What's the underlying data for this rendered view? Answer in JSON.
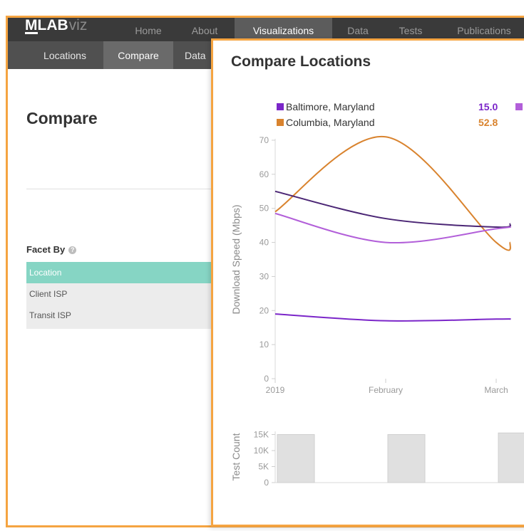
{
  "nav": {
    "logo": {
      "bold": "MLAB",
      "light": "viz"
    },
    "items": [
      "Home",
      "About",
      "Visualizations",
      "Data",
      "Tests",
      "Publications"
    ],
    "active_index": 2
  },
  "subnav": {
    "items": [
      "Locations",
      "Compare",
      "Data"
    ],
    "active_index": 1
  },
  "sidebar": {
    "title": "Compare",
    "facet_label": "Facet By",
    "facet_help_icon": "question-circle-icon",
    "options": [
      {
        "label": "Location",
        "selected": true
      },
      {
        "label": "Client ISP",
        "selected": false
      },
      {
        "label": "Transit ISP",
        "selected": false
      }
    ],
    "selected_color": "#86d5c4"
  },
  "modal": {
    "title": "Compare Locations",
    "border_color": "#f5a441"
  },
  "legend": [
    {
      "name": "Baltimore, Maryland",
      "value": "15.0",
      "color": "#7b26c9"
    },
    {
      "name": "Columbia, Maryland",
      "value": "52.8",
      "color": "#d9832e"
    }
  ],
  "chart_data": {
    "type": "line",
    "ylabel": "Download Speed (Mbps)",
    "ylim": [
      0,
      70
    ],
    "y_ticks": [
      0,
      10,
      20,
      30,
      40,
      50,
      60,
      70
    ],
    "x_ticks": [
      "2019",
      "February",
      "March"
    ],
    "x": [
      "2019-01-01",
      "2019-02-01",
      "2019-03-01"
    ],
    "series": [
      {
        "color": "#d9832e",
        "values": [
          {
            "x": "2019-01-01",
            "y": 49
          },
          {
            "x": "2019-02-01",
            "y": 71
          },
          {
            "x": "2019-03-01",
            "y": 40
          },
          {
            "x": "2019-03-05",
            "y": 40
          }
        ]
      },
      {
        "color": "#4b2675",
        "values": [
          {
            "x": "2019-01-01",
            "y": 55
          },
          {
            "x": "2019-02-01",
            "y": 47
          },
          {
            "x": "2019-03-01",
            "y": 44.5
          },
          {
            "x": "2019-03-05",
            "y": 45.5
          }
        ]
      },
      {
        "color": "#b25fd9",
        "values": [
          {
            "x": "2019-01-01",
            "y": 48.5
          },
          {
            "x": "2019-02-01",
            "y": 40
          },
          {
            "x": "2019-03-01",
            "y": 44
          },
          {
            "x": "2019-03-05",
            "y": 44.5
          }
        ]
      },
      {
        "color": "#7b26c9",
        "values": [
          {
            "x": "2019-01-01",
            "y": 19
          },
          {
            "x": "2019-02-01",
            "y": 17
          },
          {
            "x": "2019-03-01",
            "y": 17.5
          },
          {
            "x": "2019-03-05",
            "y": 17.5
          }
        ]
      }
    ],
    "count_chart": {
      "ylabel": "Test Count",
      "y_ticks": [
        "0",
        "5K",
        "10K",
        "15K"
      ],
      "ylim": [
        0,
        16000
      ],
      "bars": [
        {
          "x": "2019-01-01",
          "value": 15000
        },
        {
          "x": "2019-02-01",
          "value": 15000
        },
        {
          "x": "2019-03-01",
          "value": 15500
        }
      ],
      "bar_color": "#e0e0e0"
    },
    "grid": false
  }
}
